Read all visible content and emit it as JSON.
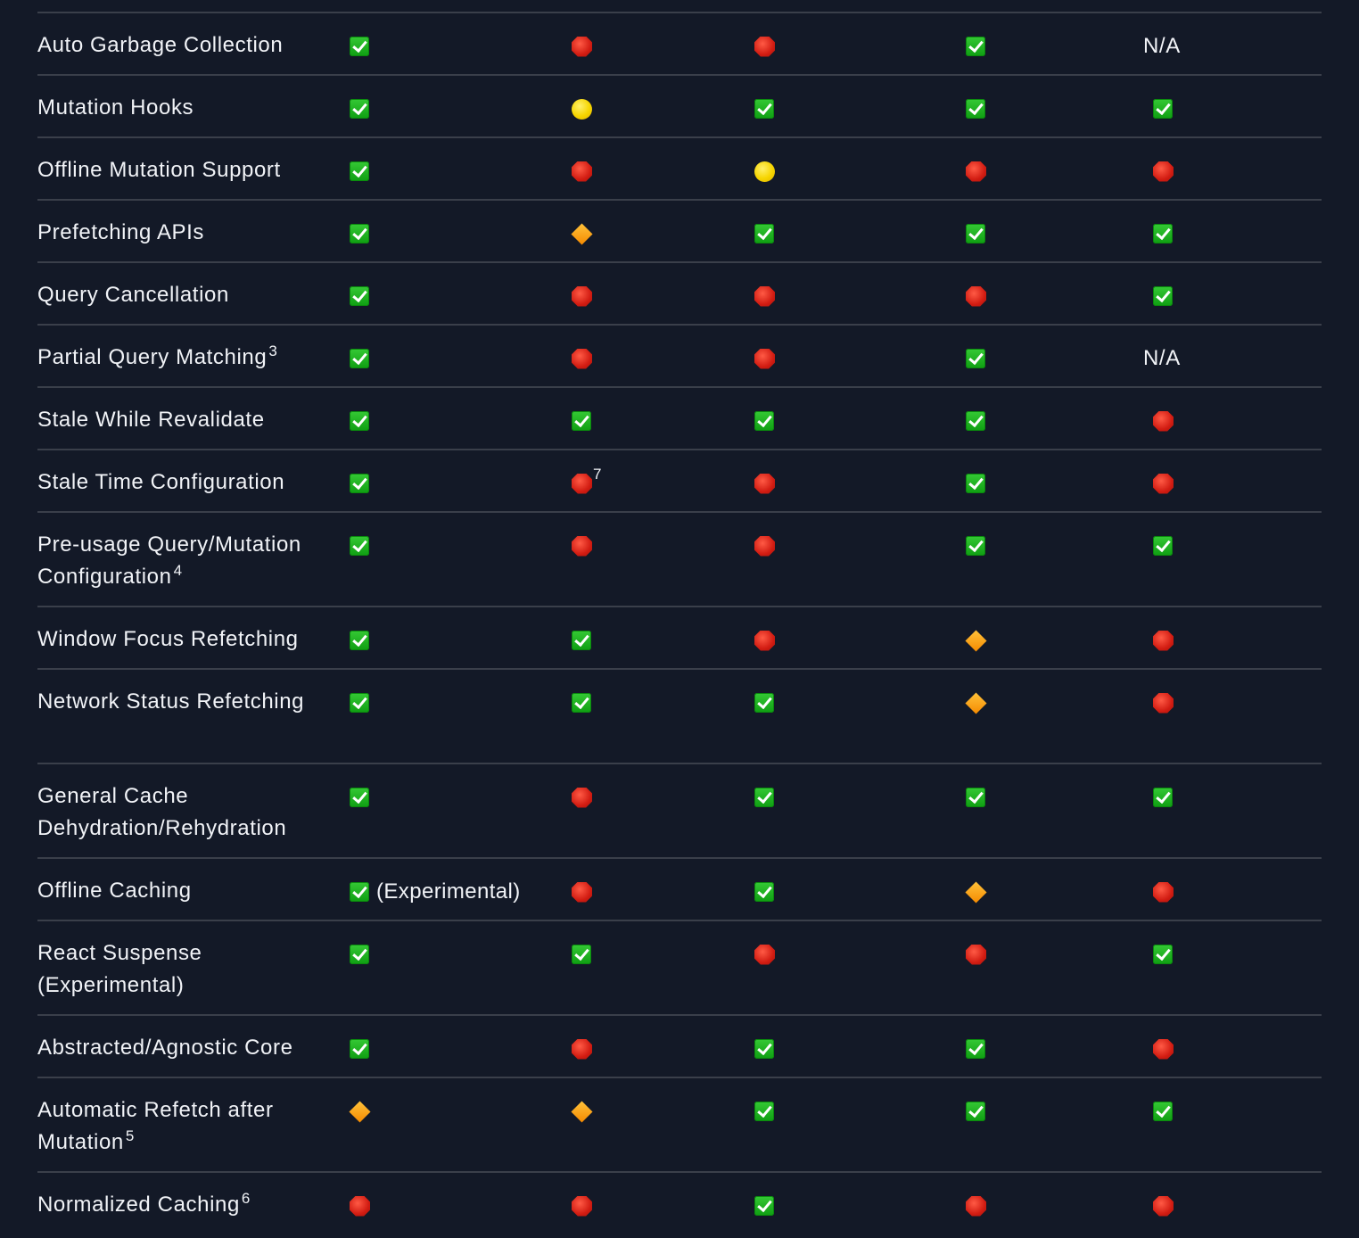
{
  "status_legend": {
    "check": "green-check-icon",
    "no": "red-stop-icon",
    "partial": "yellow-circle-icon",
    "limited": "orange-diamond-icon"
  },
  "colors": {
    "background": "#131927",
    "text": "#f1f3f7",
    "divider": "#3a3f4a"
  },
  "rows": [
    {
      "feature": "Auto Garbage Collection",
      "sup": "",
      "cells": [
        {
          "status": "check"
        },
        {
          "status": "no"
        },
        {
          "status": "no"
        },
        {
          "status": "check"
        },
        {
          "status": "na",
          "text": "N/A"
        }
      ]
    },
    {
      "feature": "Mutation Hooks",
      "sup": "",
      "cells": [
        {
          "status": "check"
        },
        {
          "status": "partial"
        },
        {
          "status": "check"
        },
        {
          "status": "check"
        },
        {
          "status": "check"
        }
      ]
    },
    {
      "feature": "Offline Mutation Support",
      "sup": "",
      "cells": [
        {
          "status": "check"
        },
        {
          "status": "no"
        },
        {
          "status": "partial"
        },
        {
          "status": "no"
        },
        {
          "status": "no"
        }
      ]
    },
    {
      "feature": "Prefetching APIs",
      "sup": "",
      "cells": [
        {
          "status": "check"
        },
        {
          "status": "limited"
        },
        {
          "status": "check"
        },
        {
          "status": "check"
        },
        {
          "status": "check"
        }
      ]
    },
    {
      "feature": "Query Cancellation",
      "sup": "",
      "cells": [
        {
          "status": "check"
        },
        {
          "status": "no"
        },
        {
          "status": "no"
        },
        {
          "status": "no"
        },
        {
          "status": "check"
        }
      ]
    },
    {
      "feature": "Partial Query Matching",
      "sup": "3",
      "cells": [
        {
          "status": "check"
        },
        {
          "status": "no"
        },
        {
          "status": "no"
        },
        {
          "status": "check"
        },
        {
          "status": "na",
          "text": "N/A"
        }
      ]
    },
    {
      "feature": "Stale While Revalidate",
      "sup": "",
      "cells": [
        {
          "status": "check"
        },
        {
          "status": "check"
        },
        {
          "status": "check"
        },
        {
          "status": "check"
        },
        {
          "status": "no"
        }
      ]
    },
    {
      "feature": "Stale Time Configuration",
      "sup": "",
      "cells": [
        {
          "status": "check"
        },
        {
          "status": "no",
          "footnote": "7"
        },
        {
          "status": "no"
        },
        {
          "status": "check"
        },
        {
          "status": "no"
        }
      ]
    },
    {
      "feature": "Pre-usage Query/Mutation Configuration",
      "sup": "4",
      "cells": [
        {
          "status": "check"
        },
        {
          "status": "no"
        },
        {
          "status": "no"
        },
        {
          "status": "check"
        },
        {
          "status": "check"
        }
      ]
    },
    {
      "feature": "Window Focus Refetching",
      "sup": "",
      "cells": [
        {
          "status": "check"
        },
        {
          "status": "check"
        },
        {
          "status": "no"
        },
        {
          "status": "limited"
        },
        {
          "status": "no"
        }
      ]
    },
    {
      "feature": "Network Status Refetching",
      "sup": "",
      "cells": [
        {
          "status": "check"
        },
        {
          "status": "check"
        },
        {
          "status": "check"
        },
        {
          "status": "limited"
        },
        {
          "status": "no"
        }
      ]
    },
    {
      "feature": "General Cache Dehydration/Rehydration",
      "sup": "",
      "cells": [
        {
          "status": "check"
        },
        {
          "status": "no"
        },
        {
          "status": "check"
        },
        {
          "status": "check"
        },
        {
          "status": "check"
        }
      ]
    },
    {
      "feature": "Offline Caching",
      "sup": "",
      "cells": [
        {
          "status": "check",
          "note": "(Experimental)"
        },
        {
          "status": "no"
        },
        {
          "status": "check"
        },
        {
          "status": "limited"
        },
        {
          "status": "no"
        }
      ]
    },
    {
      "feature": "React Suspense (Experimental)",
      "sup": "",
      "cells": [
        {
          "status": "check"
        },
        {
          "status": "check"
        },
        {
          "status": "no"
        },
        {
          "status": "no"
        },
        {
          "status": "check"
        }
      ]
    },
    {
      "feature": "Abstracted/Agnostic Core",
      "sup": "",
      "cells": [
        {
          "status": "check"
        },
        {
          "status": "no"
        },
        {
          "status": "check"
        },
        {
          "status": "check"
        },
        {
          "status": "no"
        }
      ]
    },
    {
      "feature": "Automatic Refetch after Mutation",
      "sup": "5",
      "cells": [
        {
          "status": "limited"
        },
        {
          "status": "limited"
        },
        {
          "status": "check"
        },
        {
          "status": "check"
        },
        {
          "status": "check"
        }
      ]
    },
    {
      "feature": "Normalized Caching",
      "sup": "6",
      "cells": [
        {
          "status": "no"
        },
        {
          "status": "no"
        },
        {
          "status": "check"
        },
        {
          "status": "no"
        },
        {
          "status": "no"
        }
      ]
    }
  ]
}
